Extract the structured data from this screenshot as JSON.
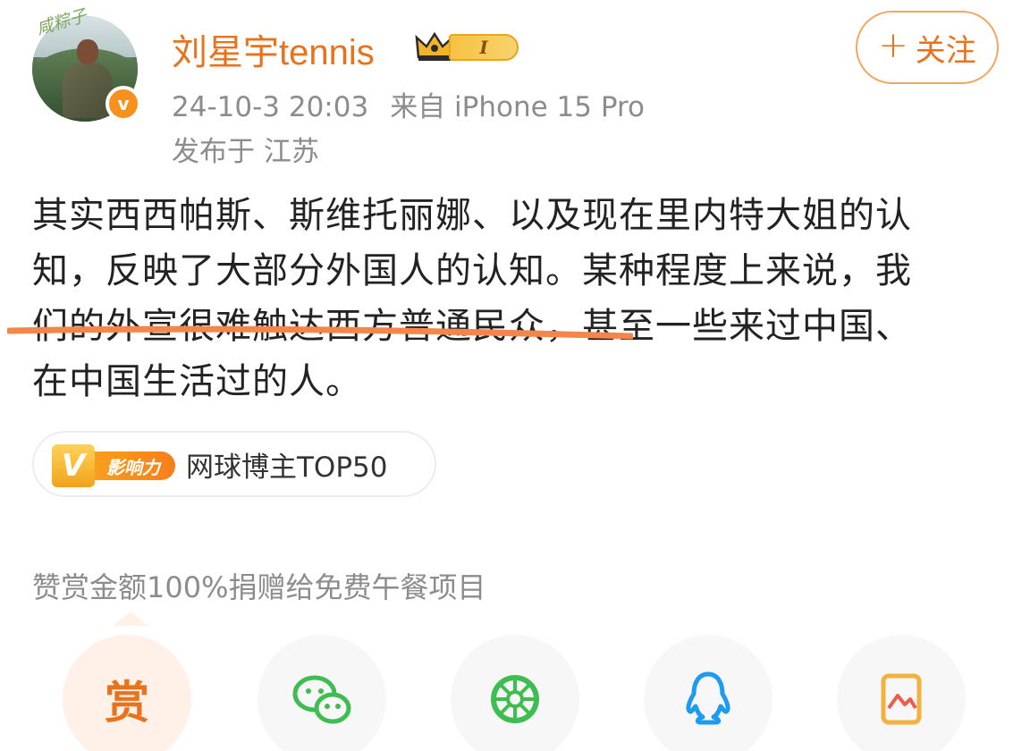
{
  "user": {
    "avatar_text": "咸粽子",
    "name": "刘星宇tennis",
    "verified_badge": "v",
    "level_tag": "I",
    "follow_button": "关注"
  },
  "post": {
    "date": "24-10-3 20:03",
    "source": "来自 iPhone 15 Pro",
    "location": "发布于 江苏",
    "lines": [
      "其实西西帕斯、斯维托丽娜、以及现在里内特大姐的认",
      "知，反映了大部分外国人的认知。某种程度上来说，我",
      "们的外宣很难触达西方普通民众，甚至一些来过中国、",
      "在中国生活过的人。"
    ]
  },
  "influence": {
    "badge_letter": "V",
    "badge_label": "影响力",
    "text": "网球博主TOP50"
  },
  "reward_note": "赞赏金额100%捐赠给免费午餐项目",
  "share": {
    "reward_label": "赏",
    "items": [
      "wechat-icon",
      "moments-icon",
      "qq-icon",
      "qzone-icon"
    ]
  },
  "colors": {
    "accent": "#e8731c",
    "underline": "#f5864a",
    "wechat": "#3ebd50",
    "qq": "#1c9bf0",
    "qzone": "#f3b23f"
  }
}
